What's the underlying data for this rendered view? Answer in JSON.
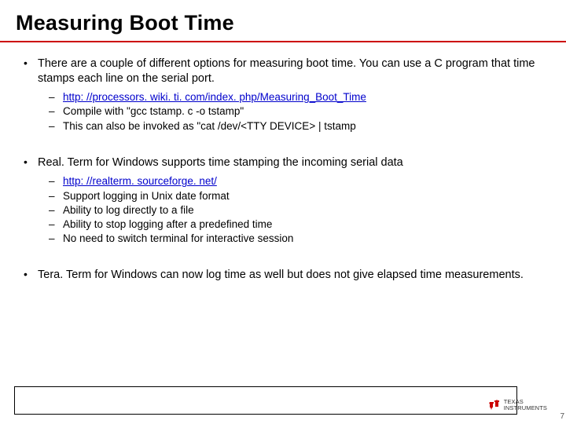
{
  "title": "Measuring Boot Time",
  "bullets": [
    {
      "text": "There are a couple of different options for measuring boot time.  You can use a C program that time stamps each line on the serial port.",
      "sub": [
        {
          "text": "http: //processors. wiki. ti. com/index. php/Measuring_Boot_Time",
          "link": true
        },
        {
          "text": "Compile with \"gcc tstamp. c -o tstamp\"",
          "link": false
        },
        {
          "text": "This can also be invoked as \"cat /dev/<TTY DEVICE> | tstamp",
          "link": false
        }
      ]
    },
    {
      "text": "Real. Term for Windows supports time stamping the incoming serial data",
      "sub": [
        {
          "text": "http: //realterm. sourceforge. net/",
          "link": true
        },
        {
          "text": "Support logging in Unix date format",
          "link": false
        },
        {
          "text": "Ability to log directly to a file",
          "link": false
        },
        {
          "text": "Ability to stop logging after a predefined time",
          "link": false
        },
        {
          "text": "No need to switch terminal for interactive session",
          "link": false
        }
      ]
    },
    {
      "text": "Tera. Term for Windows can now log time as well but does not give elapsed time measurements.",
      "sub": []
    }
  ],
  "logo": {
    "line1": "TEXAS",
    "line2": "INSTRUMENTS"
  },
  "page_number": "7"
}
